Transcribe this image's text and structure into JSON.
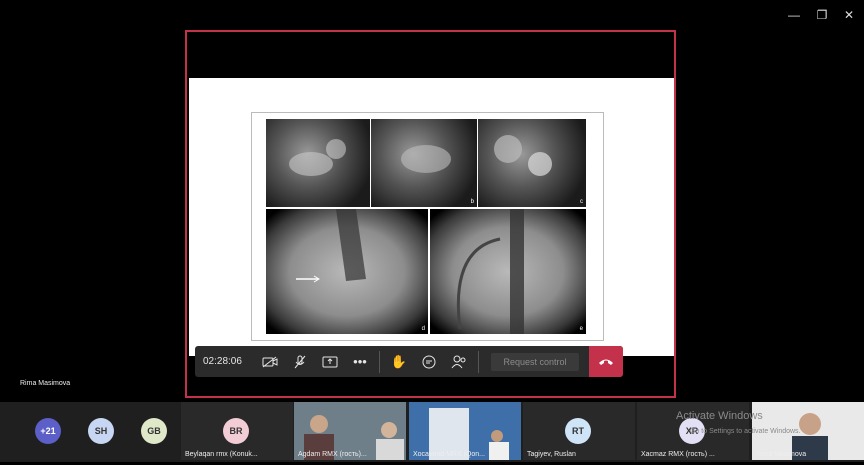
{
  "window_controls": {
    "minimize": "—",
    "maximize": "❐",
    "close": "✕"
  },
  "slide": {
    "panel_labels": [
      "b",
      "c",
      "d",
      "e"
    ]
  },
  "toolbar": {
    "timer": "02:28:06",
    "request_control": "Request control"
  },
  "presenter": "Rima Masimova",
  "overflow_count": "+21",
  "participants": [
    {
      "initials": "SH",
      "color": "#c7d6f2"
    },
    {
      "initials": "GB",
      "color": "#dfe8c8"
    },
    {
      "initials": "BR",
      "color": "#f2cdd6",
      "name": "Beylaqan rmx (Konuk..."
    },
    {
      "name": "Agdam RMX (гость)..."
    },
    {
      "name": "Xocavend MRX (Qon..."
    },
    {
      "initials": "RT",
      "color": "#cfe4f7",
      "name": "Tagiyev, Ruslan"
    },
    {
      "initials": "XR",
      "color": "#e3dff5",
      "name": "Xacmaz RMX (гость) ..."
    },
    {
      "name": "Rima Masimova"
    }
  ],
  "watermark": {
    "title": "Activate Windows",
    "subtitle": "Go to Settings to activate Windows."
  }
}
